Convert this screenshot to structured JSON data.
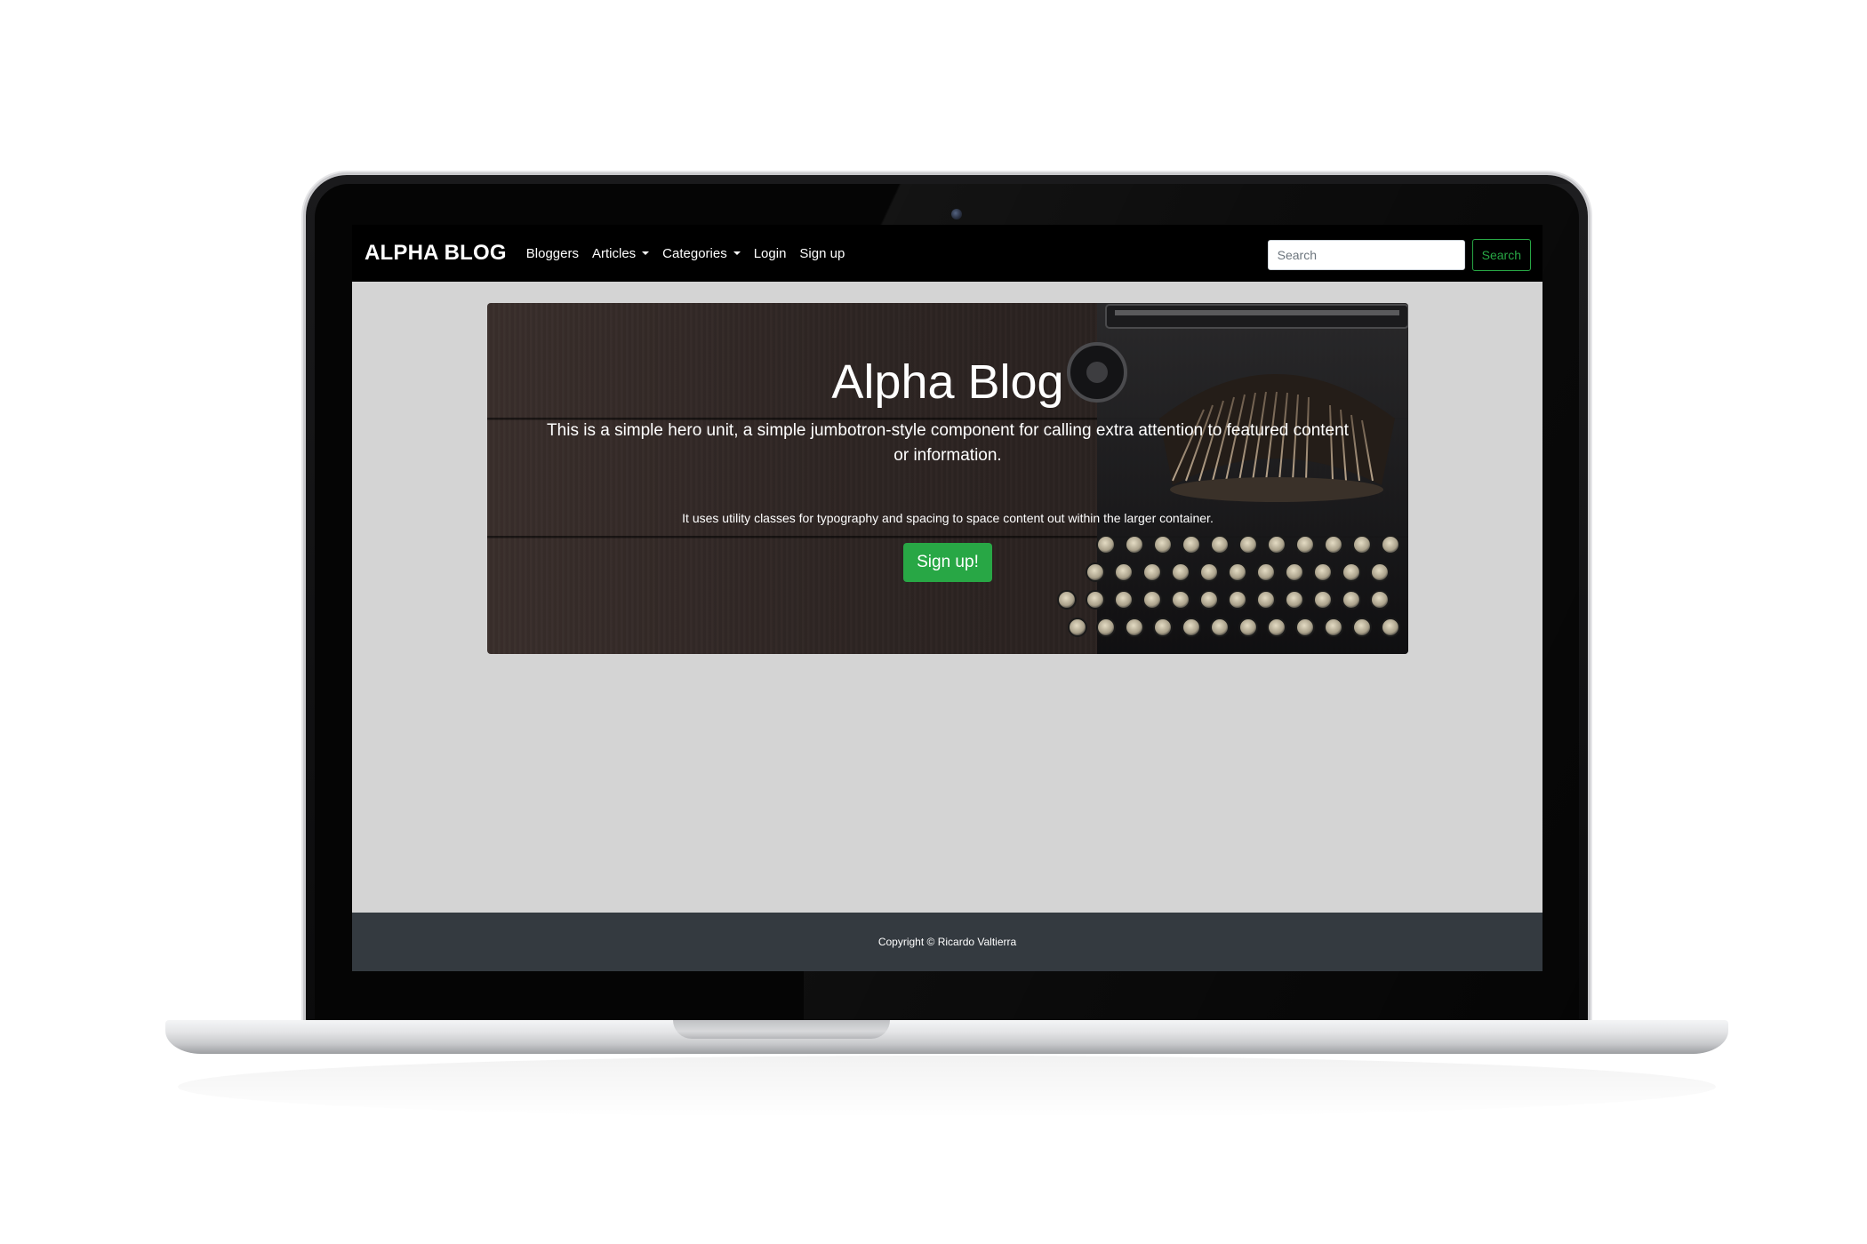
{
  "navbar": {
    "brand": "ALPHA BLOG",
    "links": [
      {
        "label": "Bloggers",
        "dropdown": false
      },
      {
        "label": "Articles",
        "dropdown": true
      },
      {
        "label": "Categories",
        "dropdown": true
      },
      {
        "label": "Login",
        "dropdown": false
      },
      {
        "label": "Sign up",
        "dropdown": false
      }
    ],
    "search": {
      "placeholder": "Search",
      "value": "",
      "button_label": "Search"
    }
  },
  "hero": {
    "title": "Alpha Blog",
    "lead": "This is a simple hero unit, a simple jumbotron-style component for calling extra attention to featured content or information.",
    "text": "It uses utility classes for typography and spacing to space content out within the larger container.",
    "button_label": "Sign up!"
  },
  "footer": {
    "copyright": "Copyright © Ricardo Valtierra"
  },
  "colors": {
    "navbar_bg": "#000000",
    "page_bg": "#d4d4d4",
    "accent_green": "#28a745",
    "footer_bg": "#343a40"
  }
}
